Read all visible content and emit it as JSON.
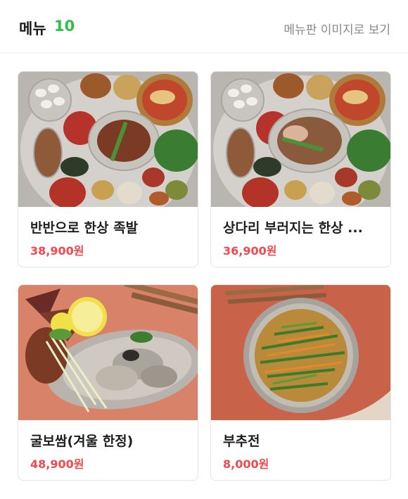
{
  "header": {
    "title": "메뉴",
    "count": "10",
    "view_image_link": "메뉴판 이미지로 보기"
  },
  "menu": [
    {
      "name": "반반으로 한상 족발",
      "price": "38,900원",
      "image": "jokbal-hansang-photo"
    },
    {
      "name": "상다리 부러지는 한상 ...",
      "price": "36,900원",
      "image": "jokbal-hansang-photo"
    },
    {
      "name": "굴보쌈(겨울 한정)",
      "price": "48,900원",
      "image": "oyster-bossam-photo"
    },
    {
      "name": "부추전",
      "price": "8,000원",
      "image": "chive-pancake-photo"
    }
  ],
  "colors": {
    "accent": "#2ac144",
    "price": "#f0494e"
  }
}
